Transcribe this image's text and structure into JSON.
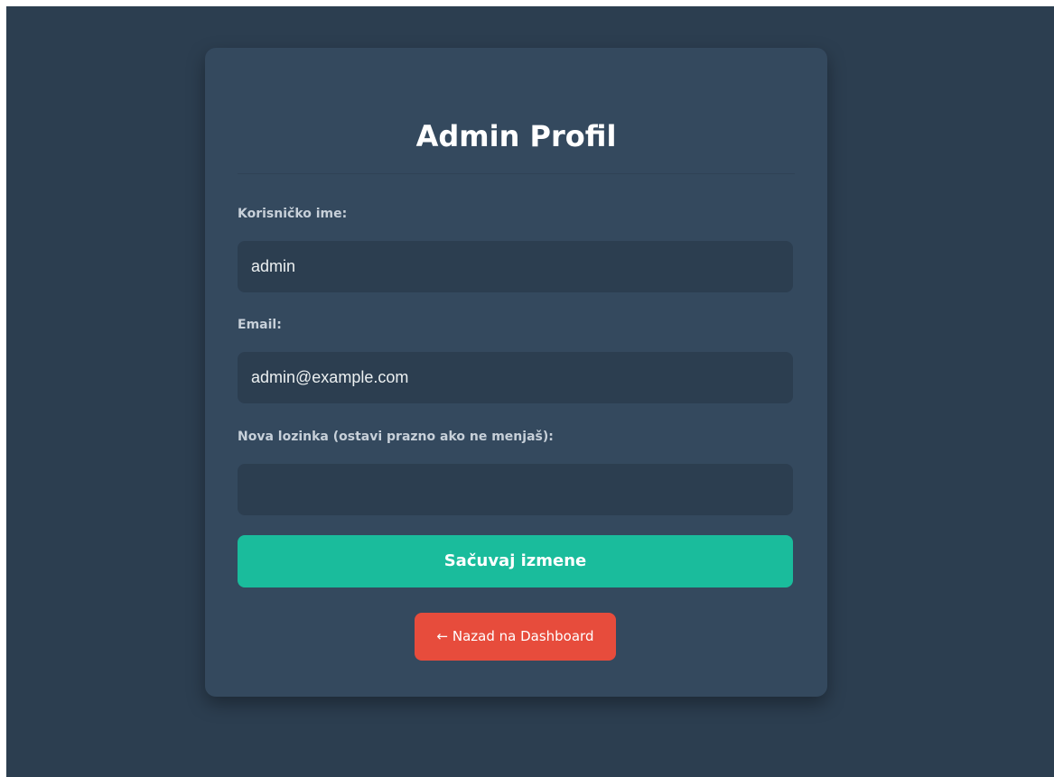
{
  "page": {
    "title": "Admin Profil"
  },
  "form": {
    "username": {
      "label": "Korisničko ime:",
      "value": "admin"
    },
    "email": {
      "label": "Email:",
      "value": "admin@example.com"
    },
    "password": {
      "label": "Nova lozinka (ostavi prazno ako ne menjaš):",
      "value": ""
    },
    "submit_label": "Sačuvaj izmene"
  },
  "back_link": {
    "label": "← Nazad na Dashboard"
  },
  "colors": {
    "background": "#2c3e50",
    "card": "#34495e",
    "input": "#2c3e50",
    "primary": "#1abc9c",
    "danger": "#e74c3c"
  }
}
